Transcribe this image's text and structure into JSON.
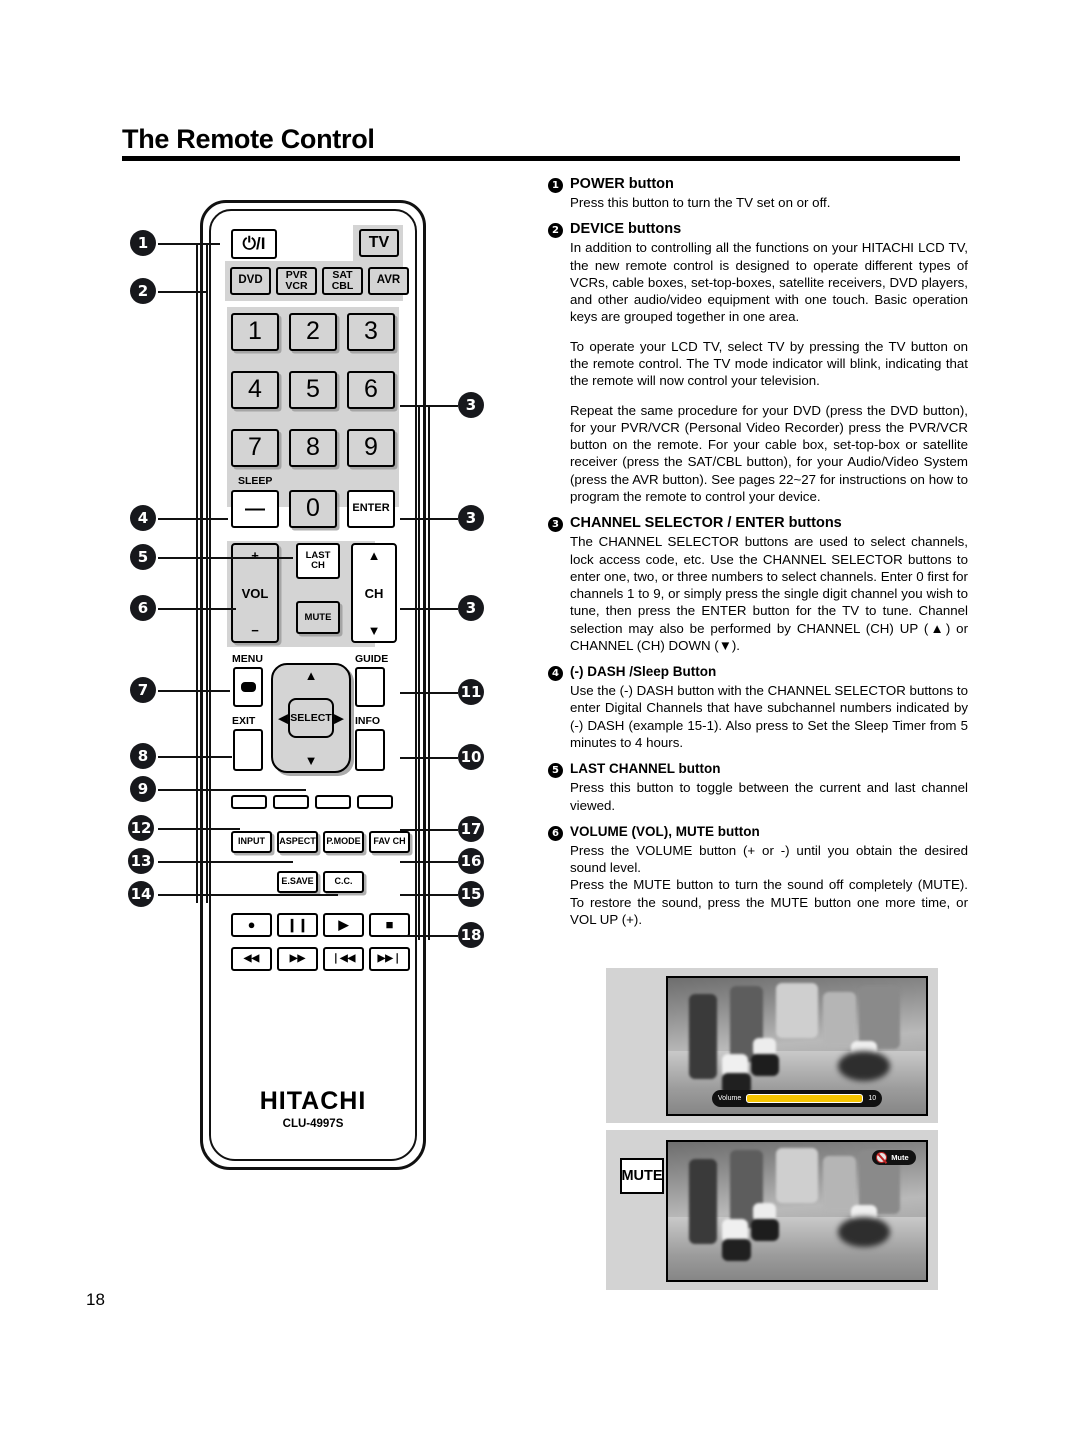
{
  "page": {
    "title": "The Remote Control",
    "number": "18"
  },
  "remote": {
    "brand": "HITACHI",
    "model": "CLU-4997S",
    "power_icon": "⏻/I",
    "device_buttons": [
      {
        "label": "TV"
      },
      {
        "label": "DVD"
      },
      {
        "label": "PVR\nVCR"
      },
      {
        "label": "SAT\nCBL"
      },
      {
        "label": "AVR"
      }
    ],
    "numeric_keys": [
      "1",
      "2",
      "3",
      "4",
      "5",
      "6",
      "7",
      "8",
      "9",
      "0"
    ],
    "sleep_label": "SLEEP",
    "dash_key": "—",
    "enter_key": "ENTER",
    "vol": {
      "plus": "+",
      "label": "VOL",
      "minus": "−"
    },
    "last_ch": "LAST\nCH",
    "mute": "MUTE",
    "ch": {
      "up": "▲",
      "label": "CH",
      "down": "▼"
    },
    "menu_label": "MENU",
    "exit_label": "EXIT",
    "guide_label": "GUIDE",
    "info_label": "INFO",
    "select_label": "SELECT",
    "function_keys": [
      "INPUT",
      "ASPECT",
      "P.MODE",
      "FAV CH"
    ],
    "function_keys_row2": [
      "E.SAVE",
      "C.C."
    ],
    "transport_row1": [
      "●",
      "❙❙",
      "▶",
      "■"
    ],
    "transport_row2": [
      "◀◀",
      "▶▶",
      "❘◀◀",
      "▶▶❘"
    ]
  },
  "callouts": {
    "left": [
      "1",
      "2",
      "4",
      "5",
      "6",
      "7",
      "8",
      "9",
      "12",
      "13",
      "14"
    ],
    "right": [
      "3",
      "3",
      "3",
      "11",
      "10",
      "17",
      "16",
      "15",
      "18"
    ]
  },
  "sections": [
    {
      "num": "1",
      "title": "POWER button",
      "paragraphs": [
        "Press this button to turn the TV set on or off."
      ]
    },
    {
      "num": "2",
      "title": "DEVICE buttons",
      "paragraphs": [
        "In addition to controlling all the functions on your HITACHI LCD TV, the new remote control is designed to operate different types of VCRs, cable boxes, set-top-boxes, satellite receivers, DVD players, and other audio/video equipment with one touch. Basic operation keys are grouped together in one area.",
        "To operate your LCD TV, select TV by pressing the TV  button on the remote control. The TV mode indicator will blink, indicating that the remote will now control your television.",
        "Repeat the same procedure for your DVD (press the DVD button), for your PVR/VCR (Personal Video Recorder) press the PVR/VCR button on the remote. For your cable box, set-top-box or satellite receiver (press the SAT/CBL button), for your Audio/Video System (press the AVR button). See pages 22~27 for instructions on how to program the remote to control your device."
      ]
    },
    {
      "num": "3",
      "title": "CHANNEL SELECTOR / ENTER buttons",
      "paragraphs": [
        "The CHANNEL SELECTOR buttons are used to select channels, lock access code, etc. Use the CHANNEL SELECTOR buttons to enter one, two, or three numbers to select channels. Enter 0 first for channels 1 to 9, or simply press the single digit channel you wish to tune, then press the ENTER button for the TV to tune. Channel selection may also be performed by CHANNEL (CH) UP (▲) or CHANNEL (CH) DOWN (▼)."
      ]
    },
    {
      "num": "4",
      "title": "(-) DASH /Sleep Button",
      "paragraphs": [
        "Use the (-) DASH button with the CHANNEL SELECTOR buttons to enter Digital Channels that have subchannel numbers indicated by (-) DASH (example 15-1). Also press to Set the Sleep Timer from 5 minutes to 4 hours."
      ]
    },
    {
      "num": "5",
      "title": "LAST CHANNEL button",
      "paragraphs": [
        "Press this button to toggle between the current and last channel viewed."
      ]
    },
    {
      "num": "6",
      "title": "VOLUME (VOL), MUTE button",
      "paragraphs": [
        "Press the VOLUME button (+ or -) until you obtain the desired sound level.",
        "Press the MUTE button to turn the sound off completely (MUTE). To restore the sound, press the MUTE button one more time, or VOL UP (+)."
      ]
    }
  ],
  "tv_examples": {
    "volume_osd": {
      "label": "Volume",
      "value": "10"
    },
    "mute_osd": {
      "label": "Mute"
    },
    "mute_tag": "MUTE"
  }
}
